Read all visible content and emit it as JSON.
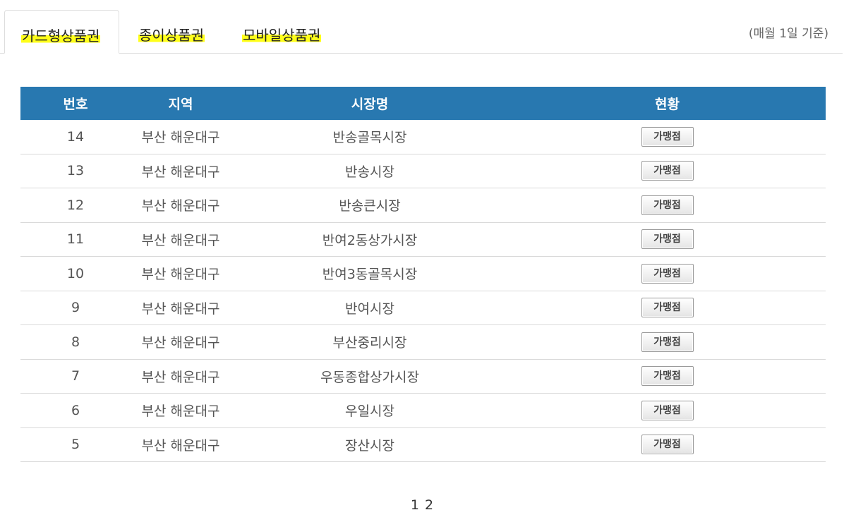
{
  "tabs": [
    {
      "label": "카드형상품권",
      "active": true
    },
    {
      "label": "종이상품권",
      "active": false
    },
    {
      "label": "모바일상품권",
      "active": false
    }
  ],
  "basis_note": "(매월 1일 기준)",
  "table": {
    "headers": [
      "번호",
      "지역",
      "시장명",
      "현황"
    ],
    "rows": [
      {
        "no": "14",
        "region": "부산 해운대구",
        "market": "반송골목시장",
        "status": "가맹점"
      },
      {
        "no": "13",
        "region": "부산 해운대구",
        "market": "반송시장",
        "status": "가맹점"
      },
      {
        "no": "12",
        "region": "부산 해운대구",
        "market": "반송큰시장",
        "status": "가맹점"
      },
      {
        "no": "11",
        "region": "부산 해운대구",
        "market": "반여2동상가시장",
        "status": "가맹점"
      },
      {
        "no": "10",
        "region": "부산 해운대구",
        "market": "반여3동골목시장",
        "status": "가맹점"
      },
      {
        "no": "9",
        "region": "부산 해운대구",
        "market": "반여시장",
        "status": "가맹점"
      },
      {
        "no": "8",
        "region": "부산 해운대구",
        "market": "부산중리시장",
        "status": "가맹점"
      },
      {
        "no": "7",
        "region": "부산 해운대구",
        "market": "우동종합상가시장",
        "status": "가맹점"
      },
      {
        "no": "6",
        "region": "부산 해운대구",
        "market": "우일시장",
        "status": "가맹점"
      },
      {
        "no": "5",
        "region": "부산 해운대구",
        "market": "장산시장",
        "status": "가맹점"
      }
    ]
  },
  "pagination": {
    "pages": [
      "1",
      "2"
    ]
  },
  "colors": {
    "header_bg": "#2878b0",
    "tab_highlight": "#ffff1a"
  }
}
